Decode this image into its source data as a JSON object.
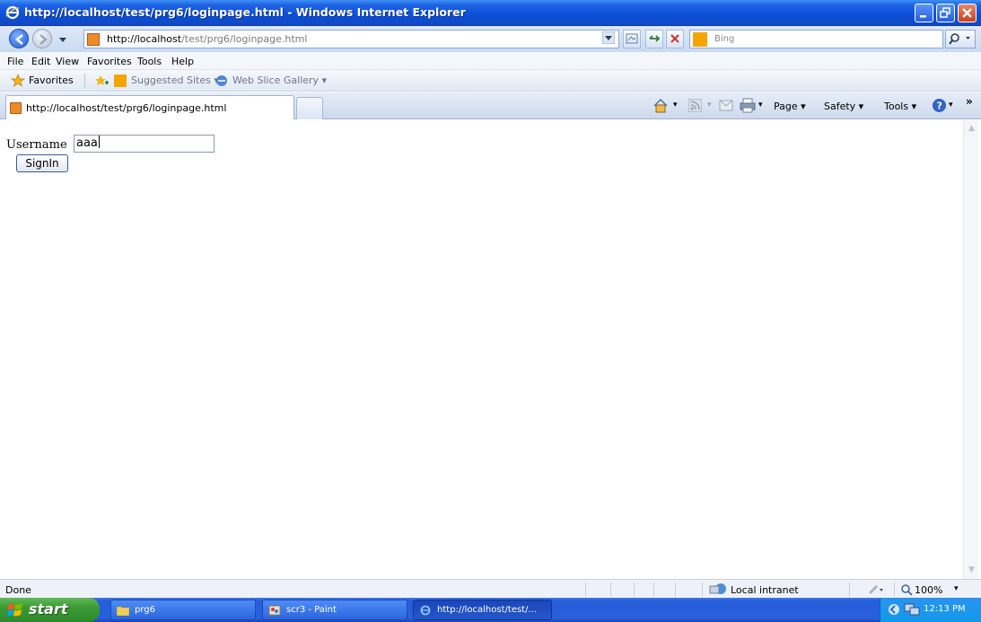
{
  "window": {
    "title": "http://localhost/test/prg6/loginpage.html - Windows Internet Explorer"
  },
  "addressbar": {
    "url_host": "http://localhost",
    "url_path": "/test/prg6/loginpage.html",
    "search_placeholder": "Bing"
  },
  "menu": [
    "File",
    "Edit",
    "View",
    "Favorites",
    "Tools",
    "Help"
  ],
  "favorites": {
    "favorites_label": "Favorites",
    "suggested_sites": "Suggested Sites ▾",
    "web_slice_gallery": "Web Slice Gallery ▾"
  },
  "tab": {
    "label": "http://localhost/test/prg6/loginpage.html"
  },
  "commandbar": {
    "page": "Page ▾",
    "safety": "Safety ▾",
    "tools": "Tools ▾",
    "more": "»"
  },
  "form": {
    "username_label": "Username",
    "username_value": "aaa",
    "signin_label": "SignIn"
  },
  "status": {
    "text": "Done",
    "zone": "Local intranet",
    "zoom": "100%"
  },
  "taskbar": {
    "start_label": "start",
    "items": [
      "prg6",
      "scr3 - Paint",
      "http://localhost/test/..."
    ],
    "clock": "12:13 PM"
  },
  "colors": {
    "titlebar": "#0b4fd8",
    "taskbar": "#245edb",
    "start": "#3b9a35"
  }
}
